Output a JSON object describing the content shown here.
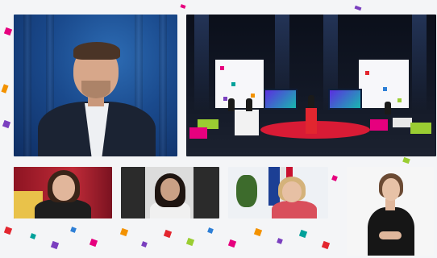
{
  "tiles": {
    "host": {
      "role": "main-speaker-feed"
    },
    "stage": {
      "role": "stage-feed"
    },
    "participants": [
      {
        "role": "participant-1"
      },
      {
        "role": "participant-2"
      },
      {
        "role": "participant-3"
      }
    ],
    "interpreter": {
      "role": "sign-language-interpreter"
    }
  },
  "colors": {
    "background": "#f4f5f7",
    "host_backdrop": "#1a4a8d",
    "stage_red": "#d81b35",
    "confetti": [
      "#e6007e",
      "#f39200",
      "#00a19a",
      "#7a3fbf",
      "#2e7fd6",
      "#e3262f",
      "#9acd32"
    ]
  }
}
